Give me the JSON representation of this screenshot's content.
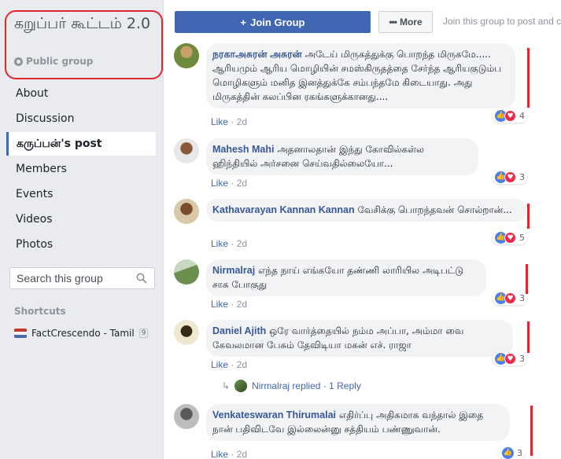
{
  "sidebar": {
    "group_name": "கறுப்பர் கூட்டம் 2.0",
    "privacy": "Public group",
    "nav": [
      "About",
      "Discussion",
      "கருப்பன்'s post",
      "Members",
      "Events",
      "Videos",
      "Photos"
    ],
    "search_placeholder": "Search this group",
    "shortcuts_heading": "Shortcuts",
    "shortcut": {
      "label": "FactCrescendo - Tamil",
      "count": "9"
    }
  },
  "topbar": {
    "join_label": "Join Group",
    "more_label": "More",
    "join_hint": "Join this group to post and c"
  },
  "comments": [
    {
      "author": "நரகாஅசுரன் அசுரன்",
      "text": "அடேய் மிருகத்துக்கு பொறந்த மிருகமே..... ஆரியமும் ஆரிய மொழியின் சமஸ்கிருதத்தை சேர்ந்த ஆரியகுடும்ப மொழிகளும் மனித இனத்துக்கே சம்பந்தமே கிடையாது. அது மிருகத்தின் கலப்பின ரகங்களுக்கானது....",
      "like": "Like",
      "time": "2d",
      "reactions": "4"
    },
    {
      "author": "Mahesh Mahi",
      "text": "அதனாலதான் இந்து கோவில்கள்ல ஹிந்தியில் அர்சனை செய்வதில்லையோ...",
      "like": "Like",
      "time": "2d",
      "reactions": "3"
    },
    {
      "author": "Kathavarayan Kannan Kannan",
      "text": "வேசிக்கு பொறந்தவன் சொல்றான்...",
      "like": "Like",
      "time": "2d",
      "reactions": "5"
    },
    {
      "author": "Nirmalraj",
      "text": "எந்த நாய் எங்கயோ தண்ணி லாரியில அடிபட்டு சாக போகுது",
      "like": "Like",
      "time": "2d",
      "reactions": "3"
    },
    {
      "author": "Daniel Ajith",
      "text": "ஒரே வார்த்தையில் நம்ம அப்பா, அம்மா வை கேவலமான பேசும் தேவிடியா மகன் எச். ராஜா",
      "like": "Like",
      "time": "2d",
      "reactions": "3"
    },
    {
      "author": "Venkateswaran Thirumalai",
      "text": "எதிர்ப்பு அதிகமாக வந்தால் இதை நான் பதிவிடவே இல்லைன்னு சத்தியம் பண்ணுவான்.",
      "like": "Like",
      "time": "2d",
      "reactions": "3"
    }
  ],
  "reply": {
    "author": "Nirmalraj",
    "action": "replied",
    "separator": "·",
    "count_label": "1 Reply"
  }
}
